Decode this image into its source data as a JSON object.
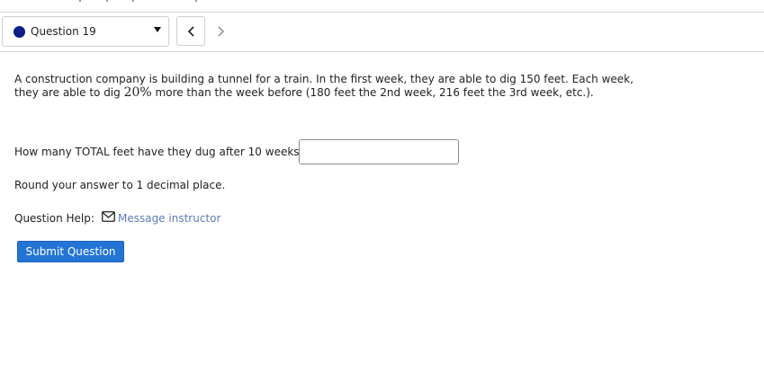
{
  "nav": {
    "question_label": "Question 19",
    "status_color": "#0b1f86",
    "prev_icon": "chevron-left-icon",
    "next_icon": "chevron-right-icon"
  },
  "problem": {
    "text_before": "A construction company is building a tunnel for a train.  In the first week, they are able to dig 150 feet.  Each week, they are able to dig ",
    "percent_value": "20",
    "percent_symbol": "%",
    "text_after": " more than the week before (180 feet the 2nd week, 216 feet the 3rd week, etc.)."
  },
  "answer": {
    "label": "How many TOTAL feet have they dug after 10 weeks?",
    "value": ""
  },
  "round_note": "Round your answer to 1 decimal place.",
  "help": {
    "label": "Question Help:",
    "icon": "mail-icon",
    "link_text": "Message instructor"
  },
  "submit_label": "Submit Question",
  "colors": {
    "accent": "#2474d6",
    "link": "#5b7db5"
  }
}
